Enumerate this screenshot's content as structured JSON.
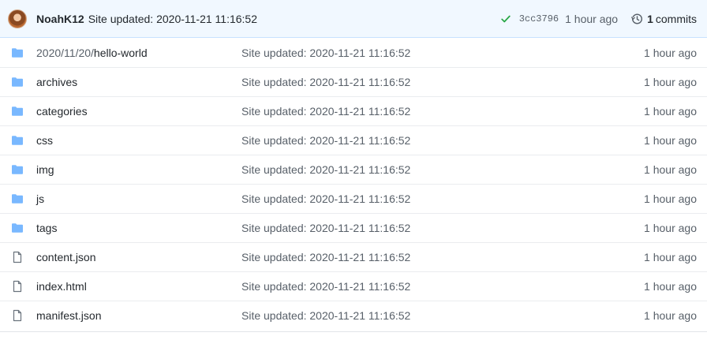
{
  "commit": {
    "author": "NoahK12",
    "message": "Site updated: 2020-11-21 11:16:52",
    "sha": "3cc3796",
    "age": "1 hour ago",
    "commits_count": "1",
    "commits_label": "commits",
    "status_color": "#28a745"
  },
  "files": [
    {
      "type": "folder",
      "prefix": "2020/11/20/",
      "name": "hello-world",
      "message": "Site updated: 2020-11-21 11:16:52",
      "age": "1 hour ago"
    },
    {
      "type": "folder",
      "prefix": "",
      "name": "archives",
      "message": "Site updated: 2020-11-21 11:16:52",
      "age": "1 hour ago"
    },
    {
      "type": "folder",
      "prefix": "",
      "name": "categories",
      "message": "Site updated: 2020-11-21 11:16:52",
      "age": "1 hour ago"
    },
    {
      "type": "folder",
      "prefix": "",
      "name": "css",
      "message": "Site updated: 2020-11-21 11:16:52",
      "age": "1 hour ago"
    },
    {
      "type": "folder",
      "prefix": "",
      "name": "img",
      "message": "Site updated: 2020-11-21 11:16:52",
      "age": "1 hour ago"
    },
    {
      "type": "folder",
      "prefix": "",
      "name": "js",
      "message": "Site updated: 2020-11-21 11:16:52",
      "age": "1 hour ago"
    },
    {
      "type": "folder",
      "prefix": "",
      "name": "tags",
      "message": "Site updated: 2020-11-21 11:16:52",
      "age": "1 hour ago"
    },
    {
      "type": "file",
      "prefix": "",
      "name": "content.json",
      "message": "Site updated: 2020-11-21 11:16:52",
      "age": "1 hour ago"
    },
    {
      "type": "file",
      "prefix": "",
      "name": "index.html",
      "message": "Site updated: 2020-11-21 11:16:52",
      "age": "1 hour ago"
    },
    {
      "type": "file",
      "prefix": "",
      "name": "manifest.json",
      "message": "Site updated: 2020-11-21 11:16:52",
      "age": "1 hour ago"
    }
  ],
  "icons": {
    "folder": "folder-icon",
    "file": "file-icon",
    "check": "check-icon",
    "history": "history-icon"
  },
  "colors": {
    "folder": "#79b8ff",
    "file": "#6a737d",
    "header_bg": "#f1f8ff"
  }
}
